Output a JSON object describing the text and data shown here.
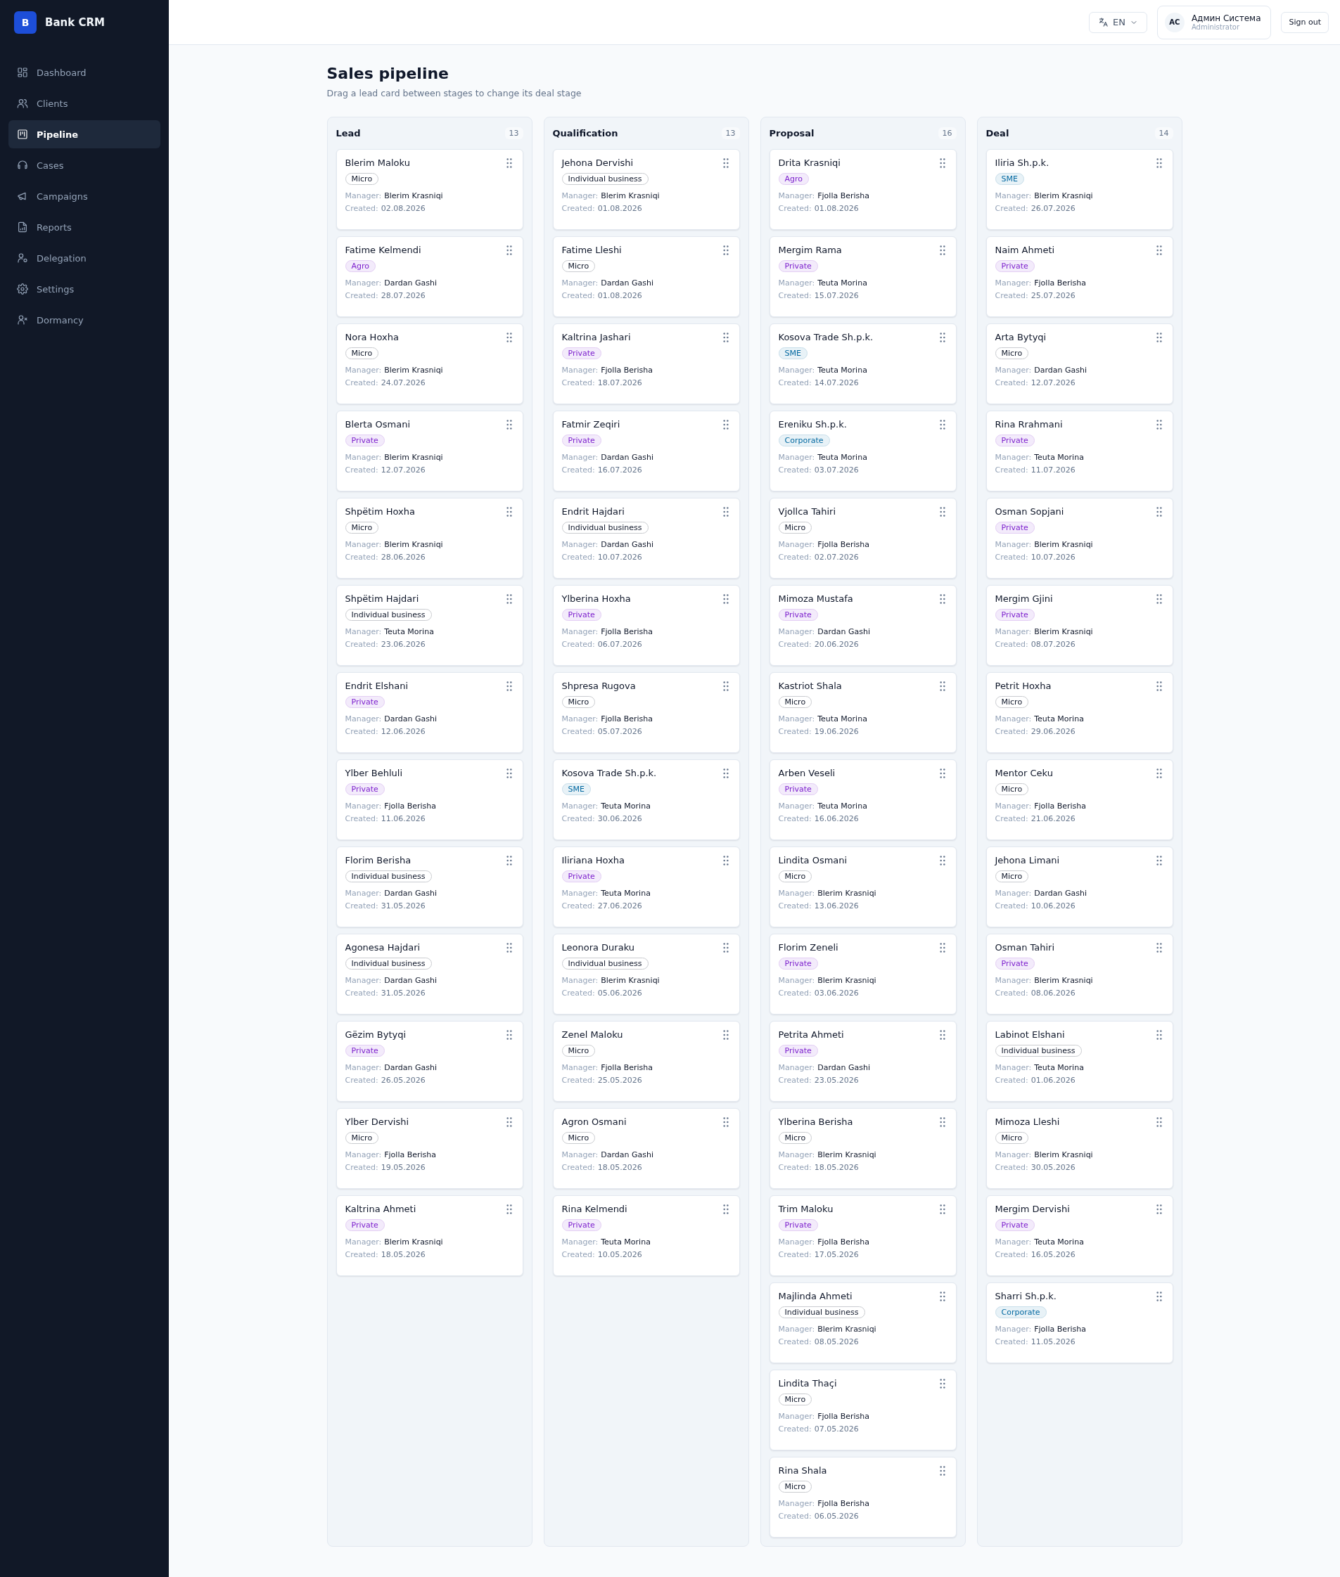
{
  "app": {
    "logo_letter": "B",
    "name": "Bank CRM"
  },
  "sidebar": {
    "items": [
      {
        "label": "Dashboard",
        "selected": false
      },
      {
        "label": "Clients",
        "selected": false
      },
      {
        "label": "Pipeline",
        "selected": true
      },
      {
        "label": "Cases",
        "selected": false
      },
      {
        "label": "Campaigns",
        "selected": false
      },
      {
        "label": "Reports",
        "selected": false
      },
      {
        "label": "Delegation",
        "selected": false
      },
      {
        "label": "Settings",
        "selected": false
      },
      {
        "label": "Dormancy",
        "selected": false
      }
    ]
  },
  "header": {
    "language": "EN",
    "user": {
      "initials": "AC",
      "name": "Админ Система",
      "role": "Administrator"
    },
    "sign_out": "Sign out"
  },
  "page": {
    "title": "Sales pipeline",
    "subtitle": "Drag a lead card between stages to change its deal stage"
  },
  "columns": [
    {
      "title": "Lead",
      "count": "13",
      "cards": [
        {
          "name": "Blerim Maloku",
          "tag": {
            "label": "Micro",
            "color": "#0f172a"
          },
          "manager_label": "Manager:",
          "manager": "Blerim Krasniqi",
          "created_label": "Created:",
          "created": "02.08.2026"
        },
        {
          "name": "Fatime Kelmendi",
          "tag": {
            "label": "Agro",
            "color": "#7e22ce"
          },
          "manager_label": "Manager:",
          "manager": "Dardan Gashi",
          "created_label": "Created:",
          "created": "28.07.2026"
        },
        {
          "name": "Nora Hoxha",
          "tag": {
            "label": "Micro",
            "color": "#0f172a"
          },
          "manager_label": "Manager:",
          "manager": "Blerim Krasniqi",
          "created_label": "Created:",
          "created": "24.07.2026"
        },
        {
          "name": "Blerta Osmani",
          "tag": {
            "label": "Private",
            "color": "#7e22ce"
          },
          "manager_label": "Manager:",
          "manager": "Blerim Krasniqi",
          "created_label": "Created:",
          "created": "12.07.2026"
        },
        {
          "name": "Shpëtim Hoxha",
          "tag": {
            "label": "Micro",
            "color": "#0f172a"
          },
          "manager_label": "Manager:",
          "manager": "Blerim Krasniqi",
          "created_label": "Created:",
          "created": "28.06.2026"
        },
        {
          "name": "Shpëtim Hajdari",
          "tag": {
            "label": "Individual business",
            "color": "#0f172a"
          },
          "manager_label": "Manager:",
          "manager": "Teuta Morina",
          "created_label": "Created:",
          "created": "23.06.2026"
        },
        {
          "name": "Endrit Elshani",
          "tag": {
            "label": "Private",
            "color": "#7e22ce"
          },
          "manager_label": "Manager:",
          "manager": "Dardan Gashi",
          "created_label": "Created:",
          "created": "12.06.2026"
        },
        {
          "name": "Ylber Behluli",
          "tag": {
            "label": "Private",
            "color": "#7e22ce"
          },
          "manager_label": "Manager:",
          "manager": "Fjolla Berisha",
          "created_label": "Created:",
          "created": "11.06.2026"
        },
        {
          "name": "Florim Berisha",
          "tag": {
            "label": "Individual business",
            "color": "#0f172a"
          },
          "manager_label": "Manager:",
          "manager": "Dardan Gashi",
          "created_label": "Created:",
          "created": "31.05.2026"
        },
        {
          "name": "Agonesa Hajdari",
          "tag": {
            "label": "Individual business",
            "color": "#0f172a"
          },
          "manager_label": "Manager:",
          "manager": "Dardan Gashi",
          "created_label": "Created:",
          "created": "31.05.2026"
        },
        {
          "name": "Gëzim Bytyqi",
          "tag": {
            "label": "Private",
            "color": "#7e22ce"
          },
          "manager_label": "Manager:",
          "manager": "Dardan Gashi",
          "created_label": "Created:",
          "created": "26.05.2026"
        },
        {
          "name": "Ylber Dervishi",
          "tag": {
            "label": "Micro",
            "color": "#0f172a"
          },
          "manager_label": "Manager:",
          "manager": "Fjolla Berisha",
          "created_label": "Created:",
          "created": "19.05.2026"
        },
        {
          "name": "Kaltrina Ahmeti",
          "tag": {
            "label": "Private",
            "color": "#7e22ce"
          },
          "manager_label": "Manager:",
          "manager": "Blerim Krasniqi",
          "created_label": "Created:",
          "created": "18.05.2026"
        }
      ]
    },
    {
      "title": "Qualification",
      "count": "13",
      "cards": [
        {
          "name": "Jehona Dervishi",
          "tag": {
            "label": "Individual business",
            "color": "#0f172a"
          },
          "manager_label": "Manager:",
          "manager": "Blerim Krasniqi",
          "created_label": "Created:",
          "created": "01.08.2026"
        },
        {
          "name": "Fatime Lleshi",
          "tag": {
            "label": "Micro",
            "color": "#0f172a"
          },
          "manager_label": "Manager:",
          "manager": "Dardan Gashi",
          "created_label": "Created:",
          "created": "01.08.2026"
        },
        {
          "name": "Kaltrina Jashari",
          "tag": {
            "label": "Private",
            "color": "#7e22ce"
          },
          "manager_label": "Manager:",
          "manager": "Fjolla Berisha",
          "created_label": "Created:",
          "created": "18.07.2026"
        },
        {
          "name": "Fatmir Zeqiri",
          "tag": {
            "label": "Private",
            "color": "#7e22ce"
          },
          "manager_label": "Manager:",
          "manager": "Dardan Gashi",
          "created_label": "Created:",
          "created": "16.07.2026"
        },
        {
          "name": "Endrit Hajdari",
          "tag": {
            "label": "Individual business",
            "color": "#0f172a"
          },
          "manager_label": "Manager:",
          "manager": "Dardan Gashi",
          "created_label": "Created:",
          "created": "10.07.2026"
        },
        {
          "name": "Ylberina Hoxha",
          "tag": {
            "label": "Private",
            "color": "#7e22ce"
          },
          "manager_label": "Manager:",
          "manager": "Fjolla Berisha",
          "created_label": "Created:",
          "created": "06.07.2026"
        },
        {
          "name": "Shpresa Rugova",
          "tag": {
            "label": "Micro",
            "color": "#0f172a"
          },
          "manager_label": "Manager:",
          "manager": "Fjolla Berisha",
          "created_label": "Created:",
          "created": "05.07.2026"
        },
        {
          "name": "Kosova Trade Sh.p.k.",
          "tag": {
            "label": "SME",
            "color": "#0369a1"
          },
          "manager_label": "Manager:",
          "manager": "Teuta Morina",
          "created_label": "Created:",
          "created": "30.06.2026"
        },
        {
          "name": "Iliriana Hoxha",
          "tag": {
            "label": "Private",
            "color": "#7e22ce"
          },
          "manager_label": "Manager:",
          "manager": "Teuta Morina",
          "created_label": "Created:",
          "created": "27.06.2026"
        },
        {
          "name": "Leonora Duraku",
          "tag": {
            "label": "Individual business",
            "color": "#0f172a"
          },
          "manager_label": "Manager:",
          "manager": "Blerim Krasniqi",
          "created_label": "Created:",
          "created": "05.06.2026"
        },
        {
          "name": "Zenel Maloku",
          "tag": {
            "label": "Micro",
            "color": "#0f172a"
          },
          "manager_label": "Manager:",
          "manager": "Fjolla Berisha",
          "created_label": "Created:",
          "created": "25.05.2026"
        },
        {
          "name": "Agron Osmani",
          "tag": {
            "label": "Micro",
            "color": "#0f172a"
          },
          "manager_label": "Manager:",
          "manager": "Dardan Gashi",
          "created_label": "Created:",
          "created": "18.05.2026"
        },
        {
          "name": "Rina Kelmendi",
          "tag": {
            "label": "Private",
            "color": "#7e22ce"
          },
          "manager_label": "Manager:",
          "manager": "Teuta Morina",
          "created_label": "Created:",
          "created": "10.05.2026"
        }
      ]
    },
    {
      "title": "Proposal",
      "count": "16",
      "cards": [
        {
          "name": "Drita Krasniqi",
          "tag": {
            "label": "Agro",
            "color": "#7e22ce"
          },
          "manager_label": "Manager:",
          "manager": "Fjolla Berisha",
          "created_label": "Created:",
          "created": "01.08.2026"
        },
        {
          "name": "Mergim Rama",
          "tag": {
            "label": "Private",
            "color": "#7e22ce"
          },
          "manager_label": "Manager:",
          "manager": "Teuta Morina",
          "created_label": "Created:",
          "created": "15.07.2026"
        },
        {
          "name": "Kosova Trade Sh.p.k.",
          "tag": {
            "label": "SME",
            "color": "#0369a1"
          },
          "manager_label": "Manager:",
          "manager": "Teuta Morina",
          "created_label": "Created:",
          "created": "14.07.2026"
        },
        {
          "name": "Ereniku Sh.p.k.",
          "tag": {
            "label": "Corporate",
            "color": "#0369a1"
          },
          "manager_label": "Manager:",
          "manager": "Teuta Morina",
          "created_label": "Created:",
          "created": "03.07.2026"
        },
        {
          "name": "Vjollca Tahiri",
          "tag": {
            "label": "Micro",
            "color": "#0f172a"
          },
          "manager_label": "Manager:",
          "manager": "Fjolla Berisha",
          "created_label": "Created:",
          "created": "02.07.2026"
        },
        {
          "name": "Mimoza Mustafa",
          "tag": {
            "label": "Private",
            "color": "#7e22ce"
          },
          "manager_label": "Manager:",
          "manager": "Dardan Gashi",
          "created_label": "Created:",
          "created": "20.06.2026"
        },
        {
          "name": "Kastriot Shala",
          "tag": {
            "label": "Micro",
            "color": "#0f172a"
          },
          "manager_label": "Manager:",
          "manager": "Teuta Morina",
          "created_label": "Created:",
          "created": "19.06.2026"
        },
        {
          "name": "Arben Veseli",
          "tag": {
            "label": "Private",
            "color": "#7e22ce"
          },
          "manager_label": "Manager:",
          "manager": "Teuta Morina",
          "created_label": "Created:",
          "created": "16.06.2026"
        },
        {
          "name": "Lindita Osmani",
          "tag": {
            "label": "Micro",
            "color": "#0f172a"
          },
          "manager_label": "Manager:",
          "manager": "Blerim Krasniqi",
          "created_label": "Created:",
          "created": "13.06.2026"
        },
        {
          "name": "Florim Zeneli",
          "tag": {
            "label": "Private",
            "color": "#7e22ce"
          },
          "manager_label": "Manager:",
          "manager": "Blerim Krasniqi",
          "created_label": "Created:",
          "created": "03.06.2026"
        },
        {
          "name": "Petrita Ahmeti",
          "tag": {
            "label": "Private",
            "color": "#7e22ce"
          },
          "manager_label": "Manager:",
          "manager": "Dardan Gashi",
          "created_label": "Created:",
          "created": "23.05.2026"
        },
        {
          "name": "Ylberina Berisha",
          "tag": {
            "label": "Micro",
            "color": "#0f172a"
          },
          "manager_label": "Manager:",
          "manager": "Blerim Krasniqi",
          "created_label": "Created:",
          "created": "18.05.2026"
        },
        {
          "name": "Trim Maloku",
          "tag": {
            "label": "Private",
            "color": "#7e22ce"
          },
          "manager_label": "Manager:",
          "manager": "Fjolla Berisha",
          "created_label": "Created:",
          "created": "17.05.2026"
        },
        {
          "name": "Majlinda Ahmeti",
          "tag": {
            "label": "Individual business",
            "color": "#0f172a"
          },
          "manager_label": "Manager:",
          "manager": "Blerim Krasniqi",
          "created_label": "Created:",
          "created": "08.05.2026"
        },
        {
          "name": "Lindita Thaçi",
          "tag": {
            "label": "Micro",
            "color": "#0f172a"
          },
          "manager_label": "Manager:",
          "manager": "Fjolla Berisha",
          "created_label": "Created:",
          "created": "07.05.2026"
        },
        {
          "name": "Rina Shala",
          "tag": {
            "label": "Micro",
            "color": "#0f172a"
          },
          "manager_label": "Manager:",
          "manager": "Fjolla Berisha",
          "created_label": "Created:",
          "created": "06.05.2026"
        }
      ]
    },
    {
      "title": "Deal",
      "count": "14",
      "cards": [
        {
          "name": "Iliria Sh.p.k.",
          "tag": {
            "label": "SME",
            "color": "#0369a1"
          },
          "manager_label": "Manager:",
          "manager": "Blerim Krasniqi",
          "created_label": "Created:",
          "created": "26.07.2026"
        },
        {
          "name": "Naim Ahmeti",
          "tag": {
            "label": "Private",
            "color": "#7e22ce"
          },
          "manager_label": "Manager:",
          "manager": "Fjolla Berisha",
          "created_label": "Created:",
          "created": "25.07.2026"
        },
        {
          "name": "Arta Bytyqi",
          "tag": {
            "label": "Micro",
            "color": "#0f172a"
          },
          "manager_label": "Manager:",
          "manager": "Dardan Gashi",
          "created_label": "Created:",
          "created": "12.07.2026"
        },
        {
          "name": "Rina Rrahmani",
          "tag": {
            "label": "Private",
            "color": "#7e22ce"
          },
          "manager_label": "Manager:",
          "manager": "Teuta Morina",
          "created_label": "Created:",
          "created": "11.07.2026"
        },
        {
          "name": "Osman Sopjani",
          "tag": {
            "label": "Private",
            "color": "#7e22ce"
          },
          "manager_label": "Manager:",
          "manager": "Blerim Krasniqi",
          "created_label": "Created:",
          "created": "10.07.2026"
        },
        {
          "name": "Mergim Gjini",
          "tag": {
            "label": "Private",
            "color": "#7e22ce"
          },
          "manager_label": "Manager:",
          "manager": "Blerim Krasniqi",
          "created_label": "Created:",
          "created": "08.07.2026"
        },
        {
          "name": "Petrit Hoxha",
          "tag": {
            "label": "Micro",
            "color": "#0f172a"
          },
          "manager_label": "Manager:",
          "manager": "Teuta Morina",
          "created_label": "Created:",
          "created": "29.06.2026"
        },
        {
          "name": "Mentor Ceku",
          "tag": {
            "label": "Micro",
            "color": "#0f172a"
          },
          "manager_label": "Manager:",
          "manager": "Fjolla Berisha",
          "created_label": "Created:",
          "created": "21.06.2026"
        },
        {
          "name": "Jehona Limani",
          "tag": {
            "label": "Micro",
            "color": "#0f172a"
          },
          "manager_label": "Manager:",
          "manager": "Dardan Gashi",
          "created_label": "Created:",
          "created": "10.06.2026"
        },
        {
          "name": "Osman Tahiri",
          "tag": {
            "label": "Private",
            "color": "#7e22ce"
          },
          "manager_label": "Manager:",
          "manager": "Blerim Krasniqi",
          "created_label": "Created:",
          "created": "08.06.2026"
        },
        {
          "name": "Labinot Elshani",
          "tag": {
            "label": "Individual business",
            "color": "#0f172a"
          },
          "manager_label": "Manager:",
          "manager": "Teuta Morina",
          "created_label": "Created:",
          "created": "01.06.2026"
        },
        {
          "name": "Mimoza Lleshi",
          "tag": {
            "label": "Micro",
            "color": "#0f172a"
          },
          "manager_label": "Manager:",
          "manager": "Blerim Krasniqi",
          "created_label": "Created:",
          "created": "30.05.2026"
        },
        {
          "name": "Mergim Dervishi",
          "tag": {
            "label": "Private",
            "color": "#7e22ce"
          },
          "manager_label": "Manager:",
          "manager": "Teuta Morina",
          "created_label": "Created:",
          "created": "16.05.2026"
        },
        {
          "name": "Sharri Sh.p.k.",
          "tag": {
            "label": "Corporate",
            "color": "#0369a1"
          },
          "manager_label": "Manager:",
          "manager": "Fjolla Berisha",
          "created_label": "Created:",
          "created": "11.05.2026"
        }
      ]
    }
  ]
}
